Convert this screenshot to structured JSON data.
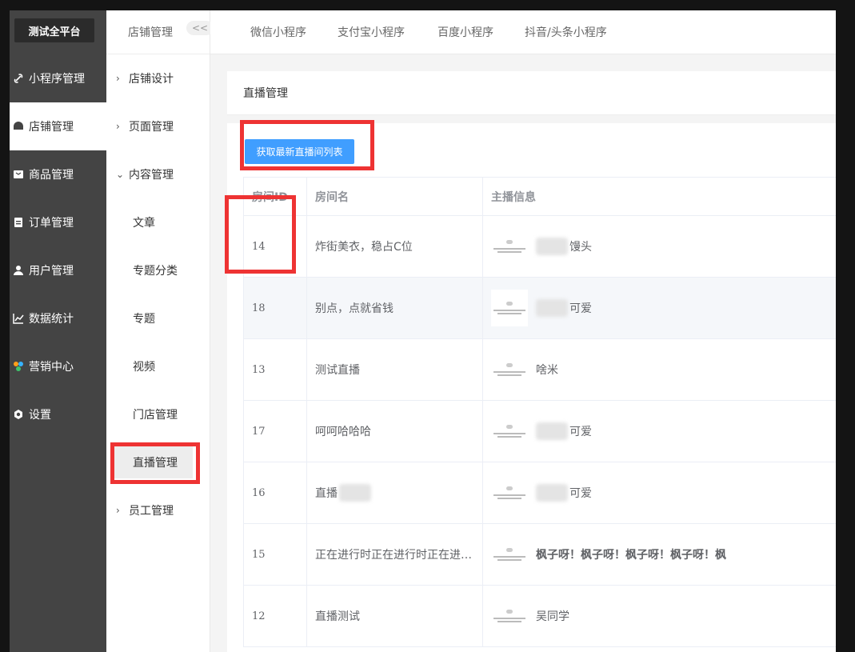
{
  "brand": "测试全平台",
  "primary_nav": [
    {
      "label": "小程序管理",
      "icon": "link-icon"
    },
    {
      "label": "店铺管理",
      "icon": "store-icon",
      "active": true
    },
    {
      "label": "商品管理",
      "icon": "product-icon"
    },
    {
      "label": "订单管理",
      "icon": "order-icon"
    },
    {
      "label": "用户管理",
      "icon": "user-icon"
    },
    {
      "label": "数据统计",
      "icon": "chart-icon"
    },
    {
      "label": "营销中心",
      "icon": "marketing-icon"
    },
    {
      "label": "设置",
      "icon": "settings-icon"
    }
  ],
  "secondary": {
    "title": "店铺管理",
    "collapse_label": "<<",
    "items": [
      {
        "label": "店铺设计",
        "type": "group"
      },
      {
        "label": "页面管理",
        "type": "group"
      },
      {
        "label": "内容管理",
        "type": "group-open"
      },
      {
        "label": "文章",
        "type": "sub"
      },
      {
        "label": "专题分类",
        "type": "sub"
      },
      {
        "label": "专题",
        "type": "sub"
      },
      {
        "label": "视频",
        "type": "sub"
      },
      {
        "label": "门店管理",
        "type": "sub"
      },
      {
        "label": "直播管理",
        "type": "sub",
        "active": true
      },
      {
        "label": "员工管理",
        "type": "group"
      }
    ]
  },
  "tabs": [
    "微信小程序",
    "支付宝小程序",
    "百度小程序",
    "抖音/头条小程序"
  ],
  "content": {
    "title": "直播管理",
    "fetch_button": "获取最新直播间列表",
    "columns": [
      "房间ID",
      "房间名",
      "主播信息"
    ],
    "rows": [
      {
        "id": "14",
        "name": "炸街美衣，稳占C位",
        "anchor": "馒头"
      },
      {
        "id": "18",
        "name": "别点，点就省钱",
        "anchor": "可爱"
      },
      {
        "id": "13",
        "name": "测试直播",
        "anchor": "啥米"
      },
      {
        "id": "17",
        "name": "呵呵哈哈哈",
        "anchor": "可爱"
      },
      {
        "id": "16",
        "name": "直播",
        "anchor": "可爱"
      },
      {
        "id": "15",
        "name": "正在进行时正在进行时正在进行时",
        "anchor": "枫子呀！枫子呀！枫子呀！枫子呀！枫"
      },
      {
        "id": "12",
        "name": "直播测试",
        "anchor": "吴同学"
      }
    ]
  },
  "colors": {
    "sidebar": "#444444",
    "primary_button": "#409eff",
    "annotation": "#ee3333"
  }
}
